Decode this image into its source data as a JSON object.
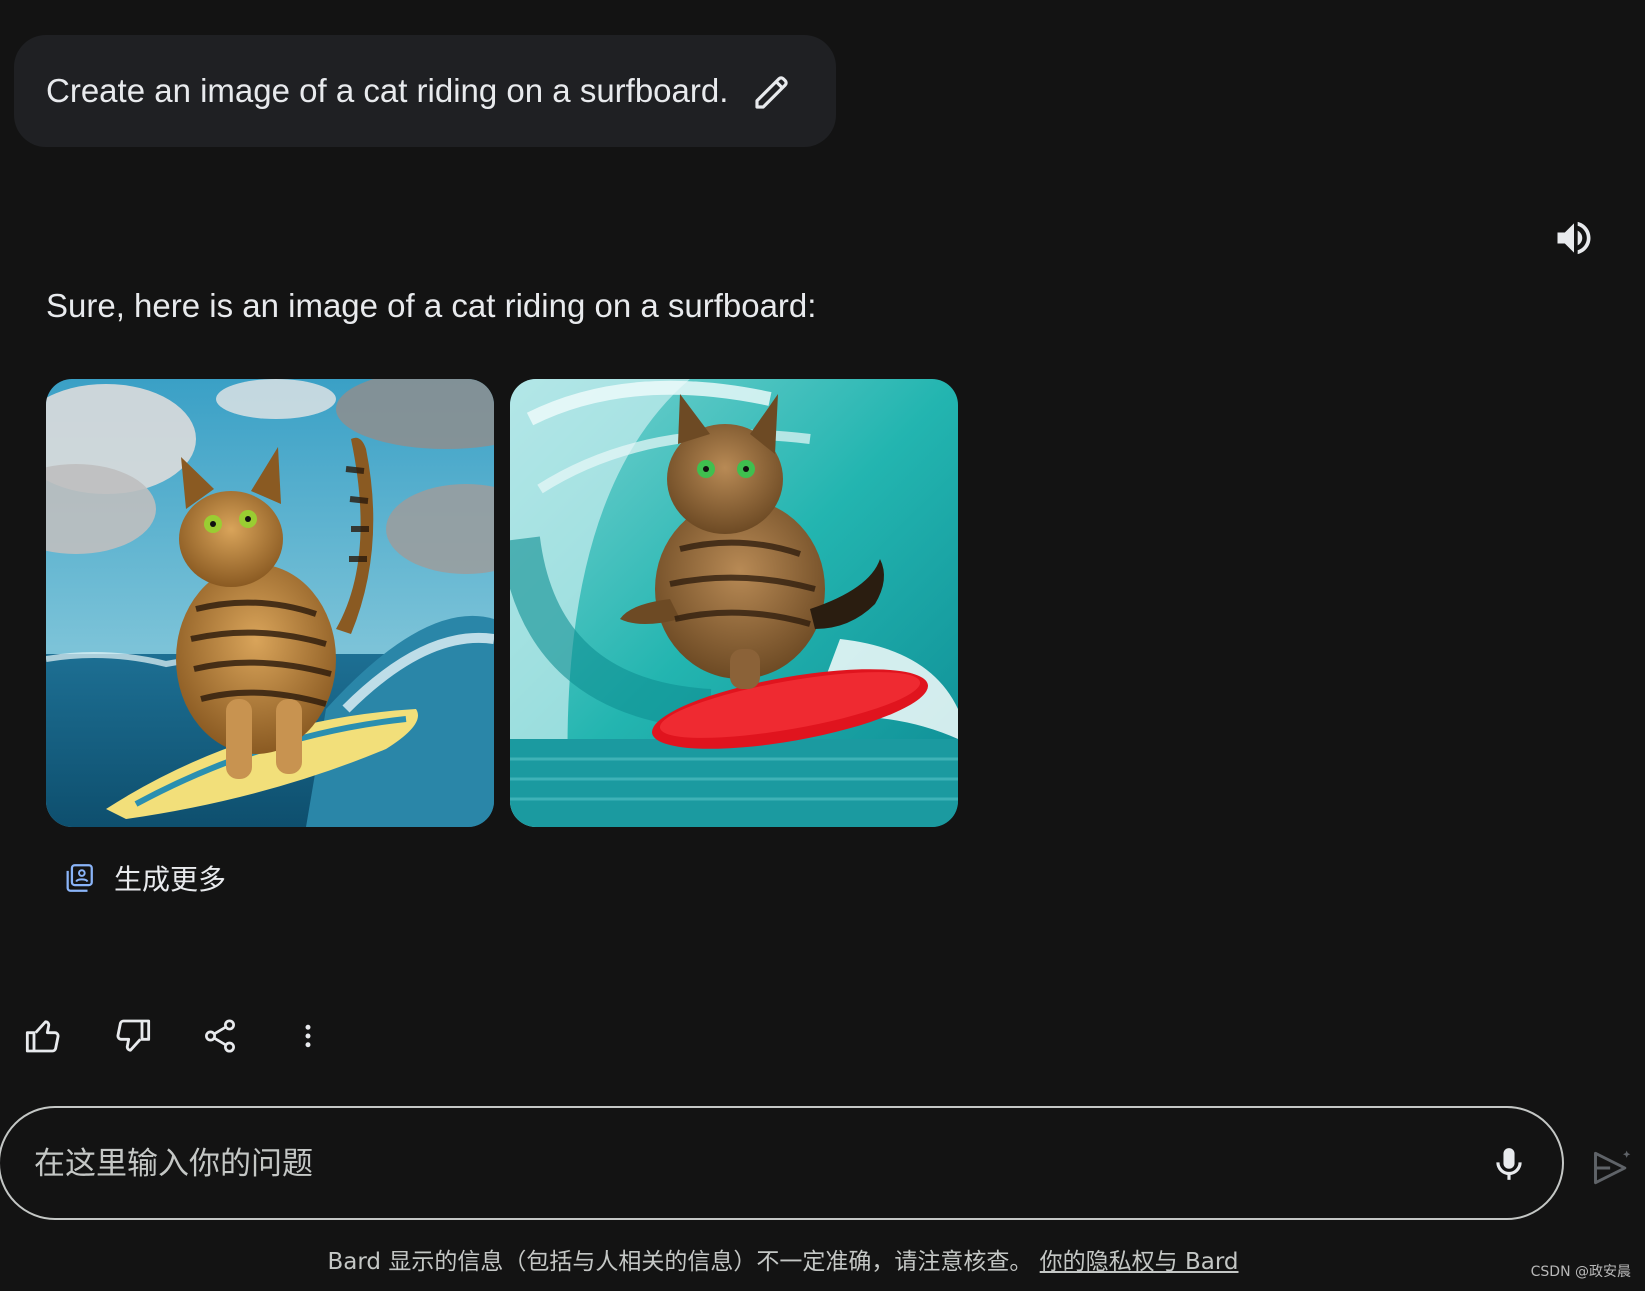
{
  "prompt": {
    "text": "Create an image of a cat riding on a surfboard."
  },
  "response": {
    "text": "Sure, here is an image of a cat riding on a surfboard:",
    "generate_more_label": "生成更多"
  },
  "input": {
    "placeholder": "在这里输入你的问题"
  },
  "footer": {
    "disclaimer": "Bard 显示的信息（包括与人相关的信息）不一定准确，请注意核查。",
    "privacy_link": "你的隐私权与 Bard"
  },
  "watermark": "CSDN @政安晨",
  "icons": {
    "edit": "pencil-icon",
    "speaker": "speaker-icon",
    "generate_more": "image-stack-icon",
    "thumbs_up": "thumbs-up-icon",
    "thumbs_down": "thumbs-down-icon",
    "share": "share-icon",
    "more": "more-vert-icon",
    "mic": "mic-icon",
    "send": "send-icon"
  },
  "colors": {
    "background": "#131313",
    "prompt_bubble": "#1f2023",
    "text": "#e8eaed",
    "accent": "#8ab4f8"
  }
}
